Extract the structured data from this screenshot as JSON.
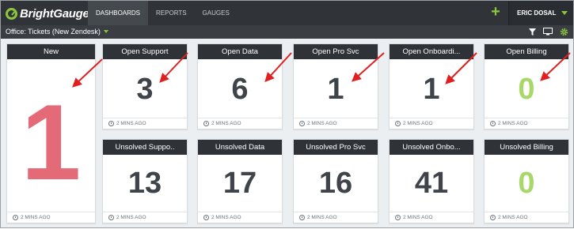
{
  "app": {
    "brand": "BrightGauge"
  },
  "nav": {
    "items": [
      "DASHBOARDS",
      "REPORTS",
      "GAUGES"
    ],
    "active": "DASHBOARDS"
  },
  "user": {
    "name": "ERIC DOSAL"
  },
  "toolbar": {
    "dashboard_name": "Office: Tickets (New Zendesk)"
  },
  "icons": {
    "plus": "plus-icon",
    "filter": "filter-icon",
    "tv": "tv-mode-icon",
    "settings": "gear-icon",
    "clock": "clock-icon",
    "caret": "chevron-down-icon"
  },
  "colors": {
    "accent": "#8cc63f",
    "big_number": "#e46a78",
    "zero_value": "#a8d86a",
    "value": "#3f444a",
    "header": "#2f3337",
    "arrow": "#e02020"
  },
  "gauges": [
    {
      "title": "New",
      "value": "1",
      "updated": "2 MINS AGO"
    },
    {
      "title": "Open Support",
      "value": "3",
      "updated": "2 MINS AGO"
    },
    {
      "title": "Open Data",
      "value": "6",
      "updated": "2 MINS AGO"
    },
    {
      "title": "Open Pro Svc",
      "value": "1",
      "updated": "2 MINS AGO"
    },
    {
      "title": "Open Onboardi...",
      "value": "1",
      "updated": "2 MINS AGO"
    },
    {
      "title": "Open Billing",
      "value": "0",
      "updated": "2 MINS AGO"
    },
    {
      "title": "Unsolved Suppo..",
      "value": "13",
      "updated": "2 MINS AGO"
    },
    {
      "title": "Unsolved Data",
      "value": "17",
      "updated": "2 MINS AGO"
    },
    {
      "title": "Unsolved Pro Svc",
      "value": "16",
      "updated": "2 MINS AGO"
    },
    {
      "title": "Unsolved Onbo...",
      "value": "41",
      "updated": "2 MINS AGO"
    },
    {
      "title": "Unsolved Billing",
      "value": "0",
      "updated": "2 MINS AGO"
    }
  ]
}
